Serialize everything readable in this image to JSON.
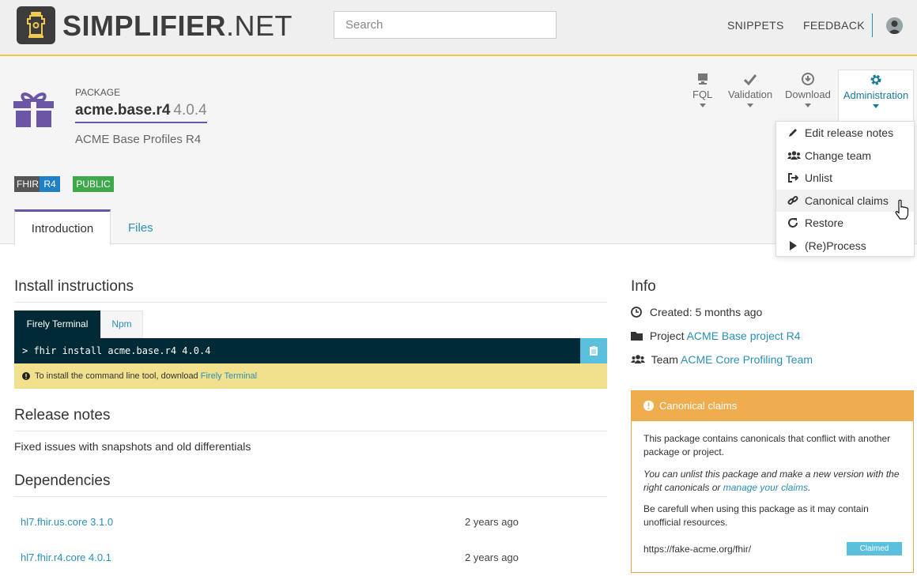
{
  "header": {
    "brand_bold": "SIMPLIFIER",
    "brand_suffix": ".NET",
    "search_placeholder": "Search",
    "nav": {
      "snippets": "SNIPPETS",
      "feedback": "FEEDBACK"
    }
  },
  "package": {
    "kicker": "PACKAGE",
    "name": "acme.base.r4",
    "version": "4.0.4",
    "description": "ACME Base Profiles R4",
    "badges": {
      "fhir": "FHIR",
      "fhir_version": "R4",
      "visibility": "PUBLIC"
    }
  },
  "toolbar": {
    "fql": "FQL",
    "validation": "Validation",
    "download": "Download",
    "administration": "Administration"
  },
  "admin_menu": [
    {
      "label": "Edit release notes",
      "icon": "pencil-icon"
    },
    {
      "label": "Change team",
      "icon": "users-icon"
    },
    {
      "label": "Unlist",
      "icon": "sign-out-icon"
    },
    {
      "label": "Canonical claims",
      "icon": "link-icon"
    },
    {
      "label": "Restore",
      "icon": "refresh-icon"
    },
    {
      "label": "(Re)Process",
      "icon": "play-icon"
    }
  ],
  "tabs": {
    "introduction": "Introduction",
    "files": "Files"
  },
  "install": {
    "heading": "Install instructions",
    "tabs": {
      "terminal": "Firely Terminal",
      "npm": "Npm"
    },
    "command": "> fhir install acme.base.r4 4.0.4",
    "note_prefix": "To install the command line tool, download",
    "note_link": "Firely Terminal"
  },
  "release_notes": {
    "heading": "Release notes",
    "text": "Fixed issues with snapshots and old differentials"
  },
  "dependencies": {
    "heading": "Dependencies",
    "items": [
      {
        "name": "hl7.fhir.us.core 3.1.0",
        "date": "2 years ago"
      },
      {
        "name": "hl7.fhir.r4.core 4.0.1",
        "date": "2 years ago"
      }
    ]
  },
  "info": {
    "heading": "Info",
    "created": "Created: 5 months ago",
    "project_label": "Project",
    "project_link": "ACME Base project R4",
    "team_label": "Team",
    "team_link": "ACME Core Profiling Team"
  },
  "claims": {
    "title": "Canonical claims",
    "p1": "This package contains canonicals that conflict with another package or project.",
    "p2_text": "You can unlist this package and make a new version with the right canonicals or",
    "p2_link": "manage your claims",
    "p2_end": ".",
    "p3": "Be carefull when using this package as it may contain unofficial resources.",
    "url": "https://fake-acme.org/fhir/",
    "status": "Claimed"
  },
  "colors": {
    "accent_purple": "#6a56a5",
    "link": "#2a8fb4",
    "terminal_bg": "#002a36",
    "warning": "#f0ad4e",
    "public_badge": "#3fa84a",
    "r4_badge": "#1f80c7"
  }
}
